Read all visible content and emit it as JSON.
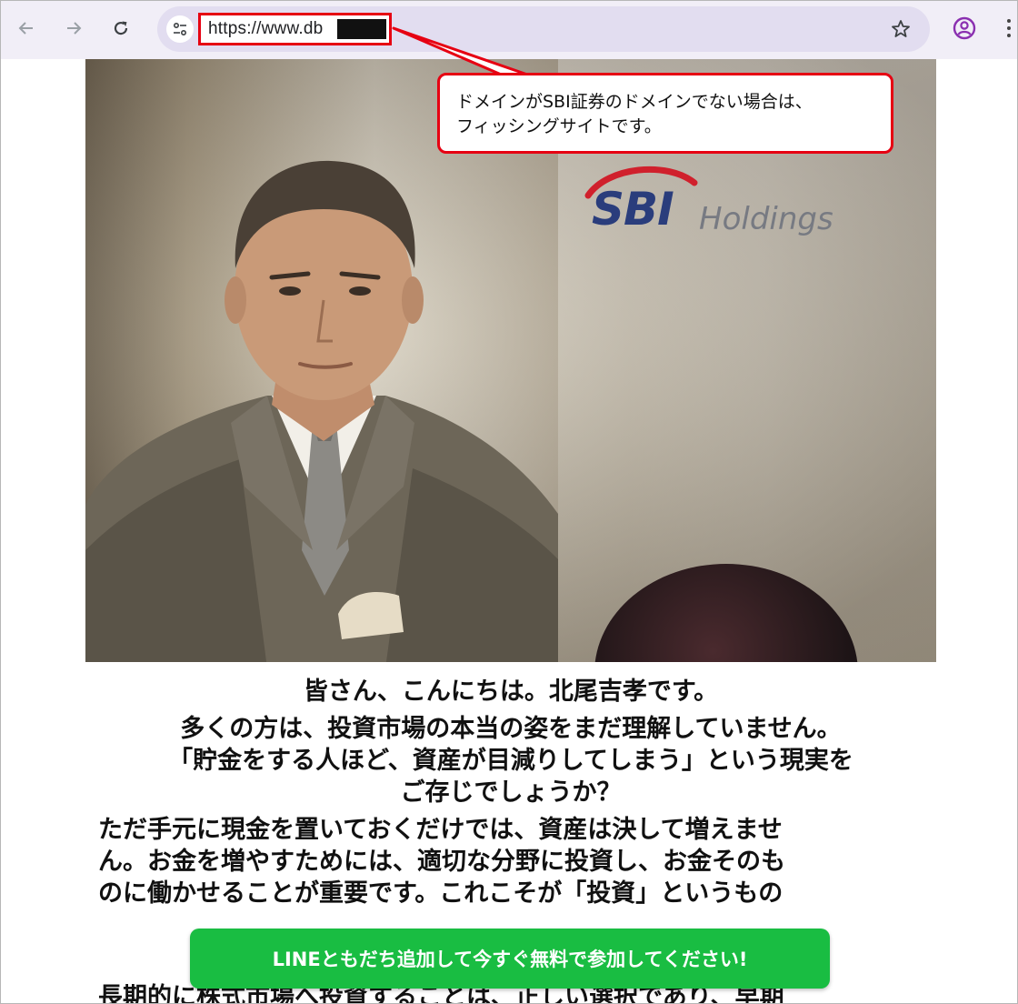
{
  "browser": {
    "url_visible": "https://www.db",
    "icons": {
      "back": "arrow-left-icon",
      "forward": "arrow-right-icon",
      "reload": "reload-icon",
      "site_info": "tune-icon",
      "bookmark": "star-icon",
      "profile": "account-circle-icon",
      "menu": "kebab-menu-icon"
    }
  },
  "callout": {
    "line1": "ドメインがSBI証券のドメインでない場合は、",
    "line2": "フィッシングサイトです。"
  },
  "hero": {
    "logo_sbi": "SBI",
    "logo_holdings": "Holdings"
  },
  "article": {
    "greeting": "皆さん、こんにちは。北尾吉孝です。",
    "line_many": "多くの方は、投資市場の本当の姿をまだ理解していません。",
    "quote_line1": "「貯金をする人ほど、資産が目減りしてしまう」という現実を",
    "quote_line2": "ご存じでしょうか？",
    "hand_line1": "ただ手元に現金を置いておくだけでは、資産は決して増えませ",
    "hand_line2": "ん。お金を増やすためには、適切な分野に投資し、お金そのも",
    "hand_line3": "のに働かせることが重要です。これこそが「投資」というもの",
    "long_line": "長期的に株式市場へ投資することは、正しい選択であり、早期"
  },
  "cta": {
    "label": "LINEともだち追加して今すぐ無料で参加してください!"
  },
  "colors": {
    "highlight_red": "#e60012",
    "cta_green": "#19bd42",
    "toolbar_bg": "#f1eef7",
    "omnibox_bg": "#e2ddf0",
    "logo_navy": "#2a3d7c"
  }
}
